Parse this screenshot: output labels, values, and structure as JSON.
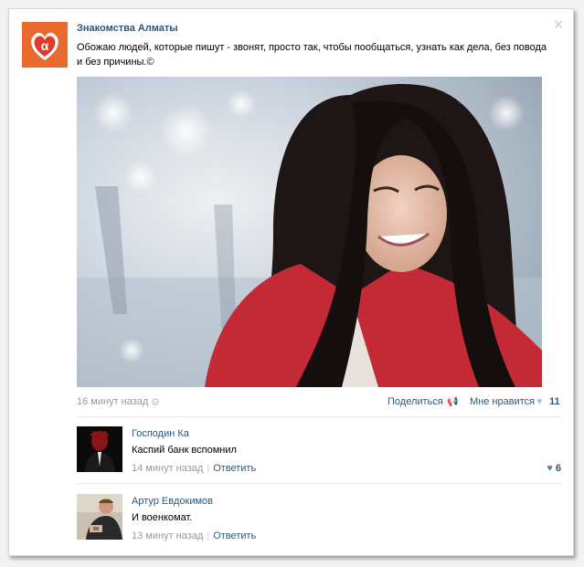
{
  "post": {
    "group_name": "Знакомства Алматы",
    "text": "Обожаю людей, которые пишут - звонят, просто так, чтобы пообщаться, узнать как дела, без повода и без причины.©",
    "time": "16 минут назад",
    "share_label": "Поделиться",
    "like_label": "Мне нравится",
    "like_count": "11",
    "close_icon": "close-icon"
  },
  "comments": [
    {
      "author": "Господин Ка",
      "text": "Каспий банк вспомнил",
      "time": "14 минут назад",
      "reply_label": "Ответить",
      "likes": "6"
    },
    {
      "author": "Артур Евдокимов",
      "text": "И военкомат.",
      "time": "13 минут назад",
      "reply_label": "Ответить",
      "likes": ""
    }
  ],
  "colors": {
    "link": "#2b587a",
    "meta": "#999999",
    "accent": "#e85a2c"
  }
}
